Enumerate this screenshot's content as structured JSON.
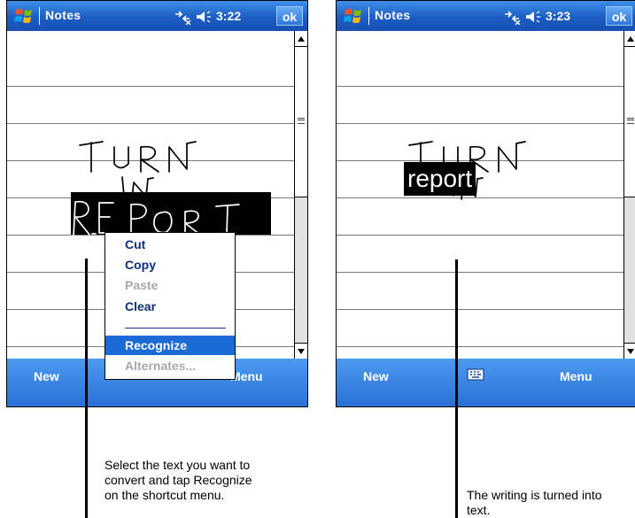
{
  "colors": {
    "titlebar": "#1c5dc4",
    "menubar": "#2a6fd4",
    "menu_text": "#0b2f7a",
    "highlight": "#1c6ad6",
    "disabled": "#a9a9a9"
  },
  "left_screen": {
    "title": "Notes",
    "time": "3:22",
    "ok_label": "ok",
    "menubar": {
      "new_label": "New",
      "menu_label": "Menu"
    },
    "context_menu": {
      "items": [
        {
          "label": "Cut",
          "state": "enabled"
        },
        {
          "label": "Copy",
          "state": "enabled"
        },
        {
          "label": "Paste",
          "state": "disabled"
        },
        {
          "label": "Clear",
          "state": "enabled"
        },
        {
          "label": "Recognize",
          "state": "highlighted"
        },
        {
          "label": "Alternates...",
          "state": "disabled"
        }
      ]
    },
    "caption": "Select the text you want to\nconvert and tap Recognize\non the shortcut menu."
  },
  "right_screen": {
    "title": "Notes",
    "time": "3:23",
    "ok_label": "ok",
    "recognized_text": "report",
    "menubar": {
      "new_label": "New",
      "menu_label": "Menu",
      "keyboard_icon": "keyboard-icon"
    },
    "caption": "The writing is turned into\ntext."
  }
}
